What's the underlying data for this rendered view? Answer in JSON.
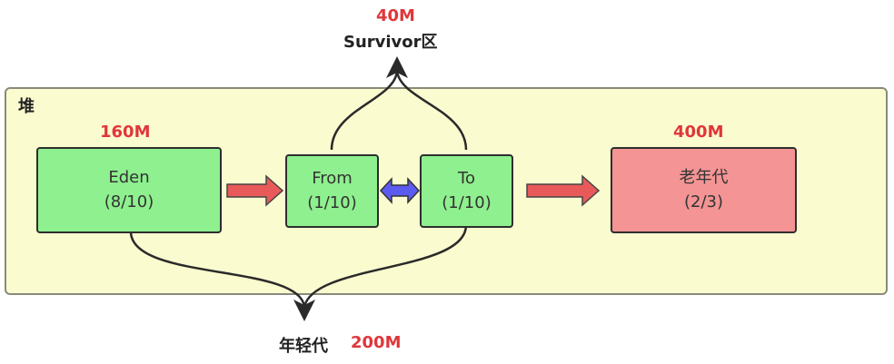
{
  "survivor": {
    "size": "40M",
    "label": "Survivor区"
  },
  "heap": {
    "label": "堆"
  },
  "eden": {
    "size": "160M",
    "name": "Eden",
    "ratio": "(8/10)"
  },
  "from": {
    "name": "From",
    "ratio": "(1/10)"
  },
  "to": {
    "name": "To",
    "ratio": "(1/10)"
  },
  "old": {
    "size": "400M",
    "name": "老年代",
    "ratio": "(2/3)"
  },
  "young": {
    "label": "年轻代",
    "size": "200M"
  },
  "colors": {
    "heap_bg": "#fbfbd0",
    "young_box": "#8ef08e",
    "old_box": "#f49494",
    "size_text": "#e0363a",
    "arrow_red": "#e85a5a",
    "arrow_blue": "#5b5bf0"
  }
}
